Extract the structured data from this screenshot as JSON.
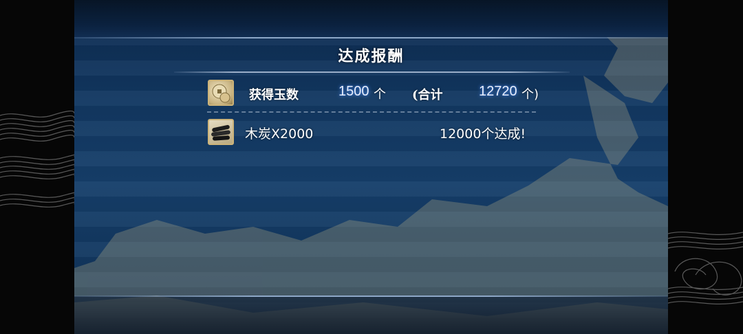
{
  "dialog": {
    "title": "达成报酬"
  },
  "jade_row": {
    "icon": "jade-coin-icon",
    "label": "获得玉数",
    "amount": "1500",
    "amount_unit": "个",
    "total_open": "(合计",
    "total": "12720",
    "total_unit": "个)"
  },
  "reward_row": {
    "icon": "charcoal-icon",
    "item": "木炭X2000",
    "condition": "12000个达成!"
  },
  "colors": {
    "background_blue": "#163f6b",
    "number_glow": "#4f8df0",
    "icon_frame": "#cdb47a"
  }
}
